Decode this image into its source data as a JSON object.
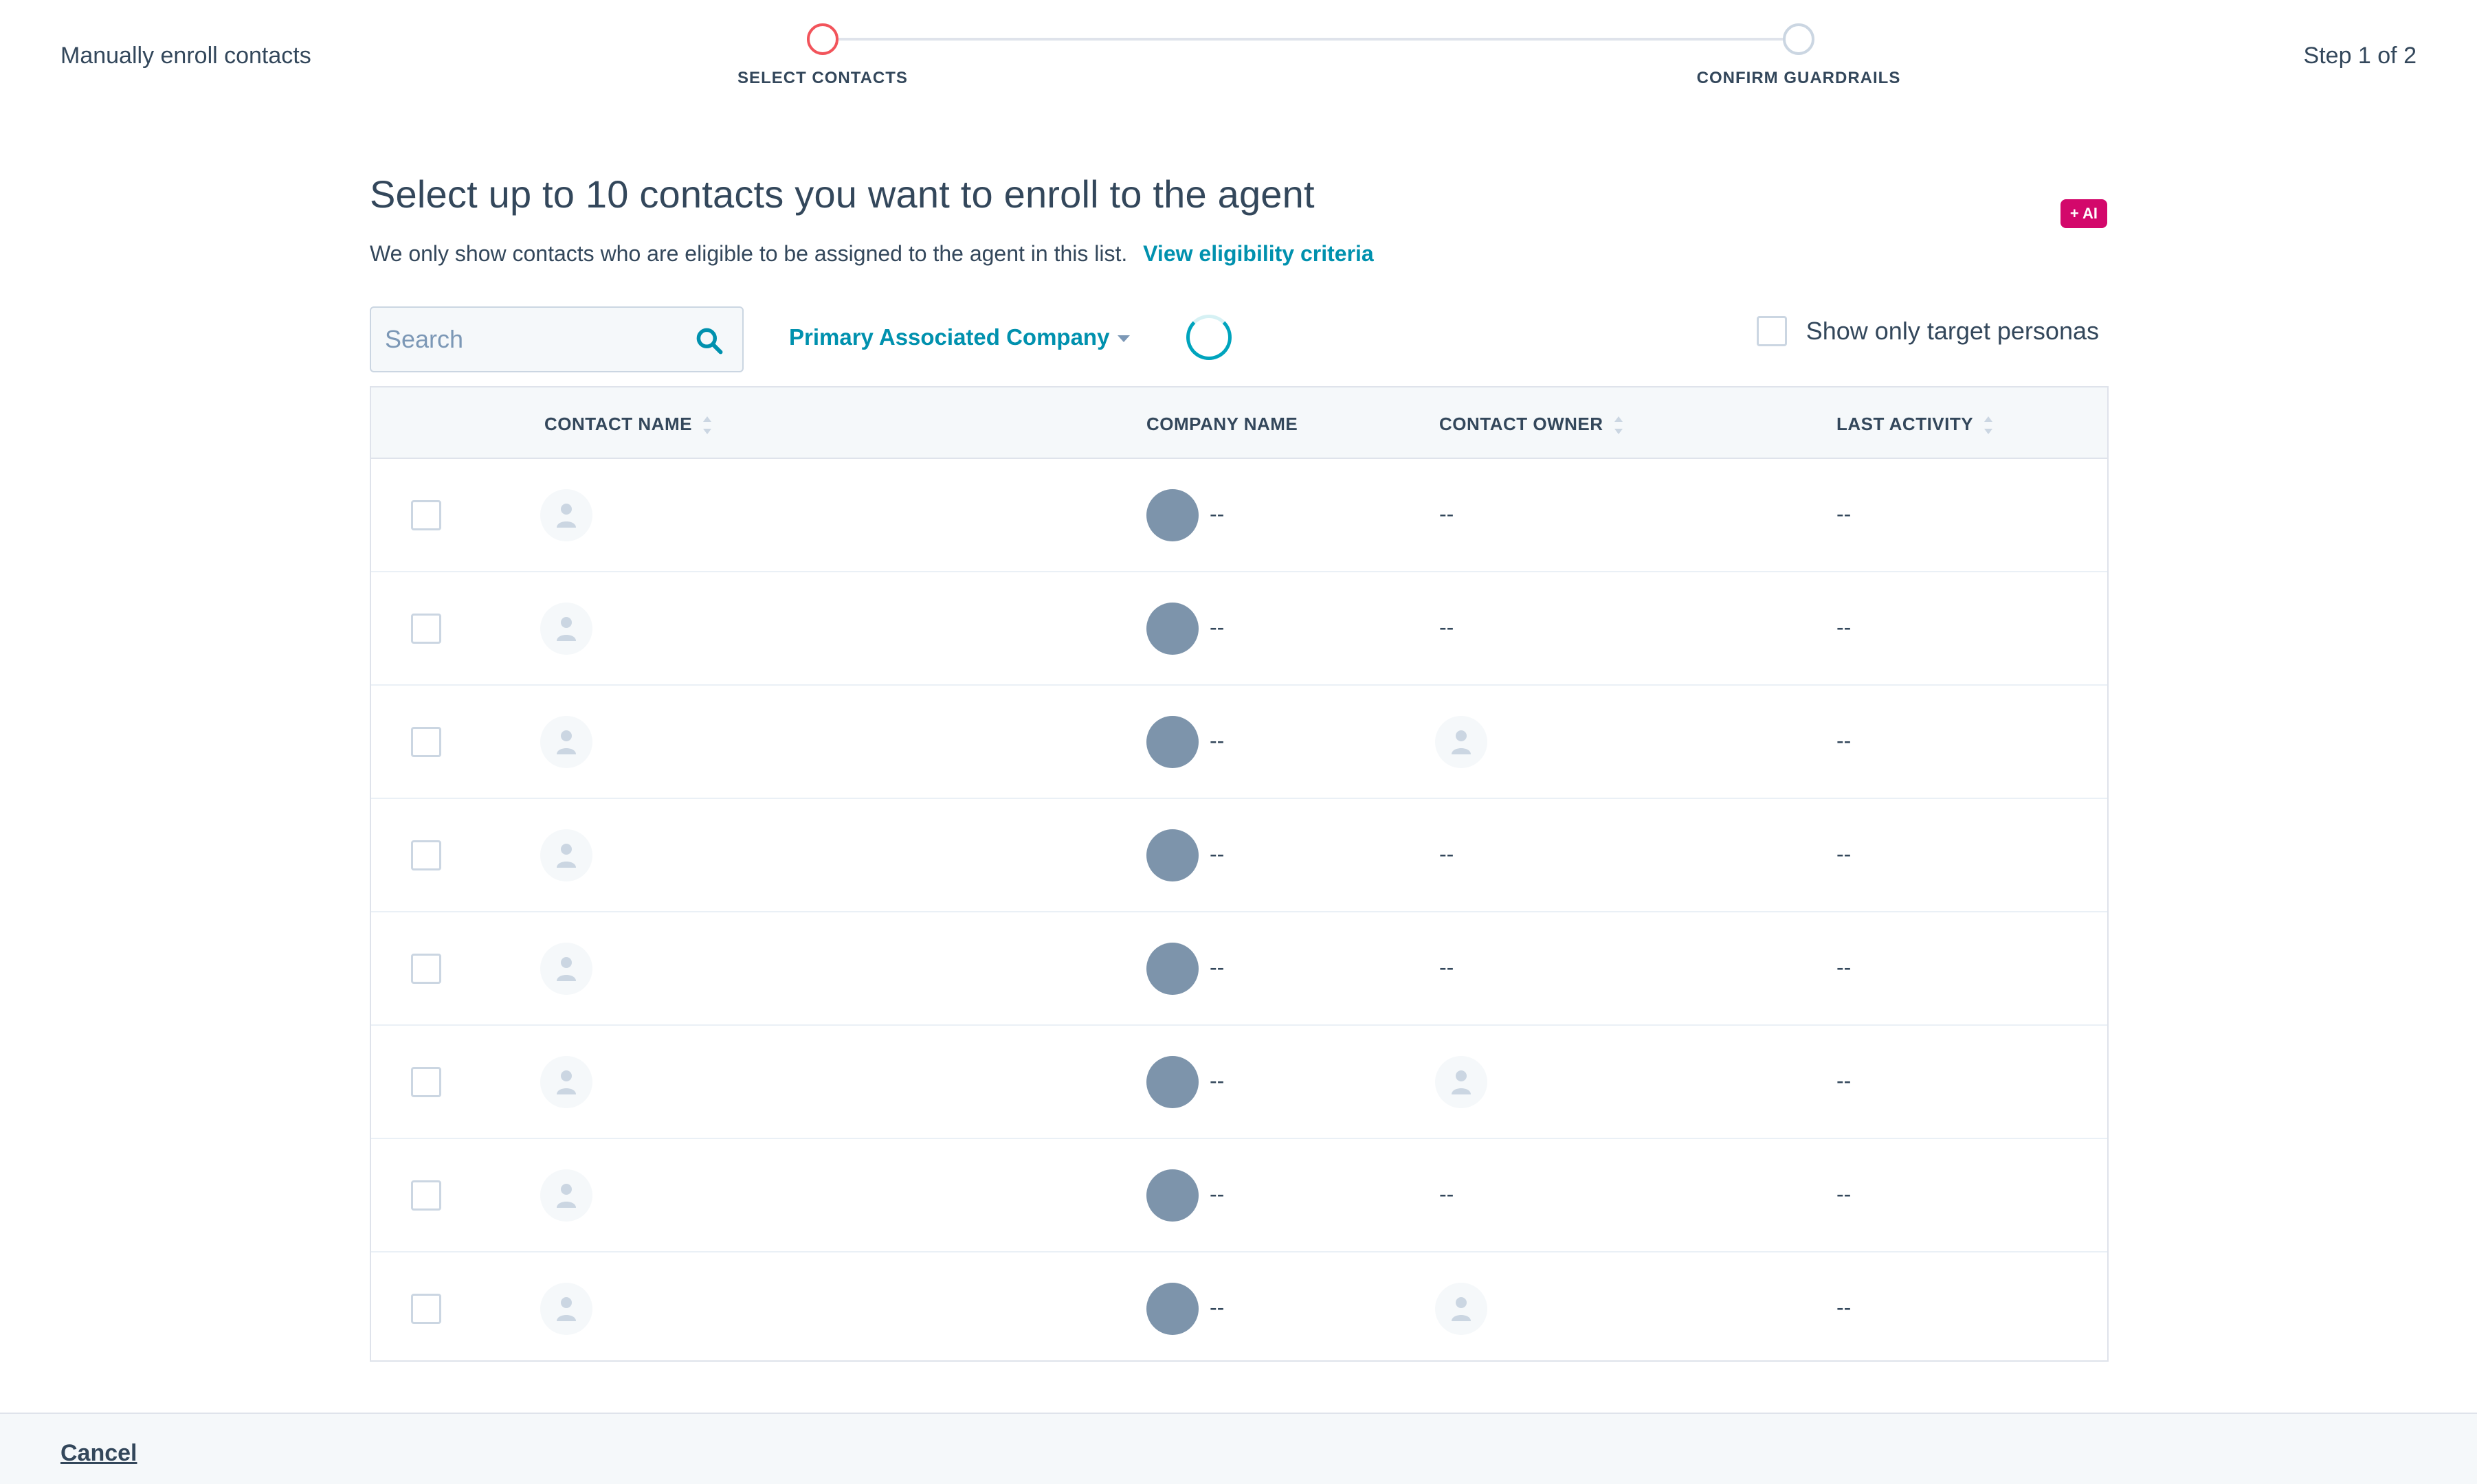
{
  "header": {
    "title": "Manually enroll contacts",
    "step_counter": "Step 1 of 2",
    "steps": [
      {
        "label": "SELECT CONTACTS",
        "state": "active"
      },
      {
        "label": "CONFIRM GUARDRAILS",
        "state": "inactive"
      }
    ]
  },
  "main": {
    "title": "Select up to 10 contacts you want to enroll to the agent",
    "ai_badge": "+ AI",
    "subtitle": "We only show contacts who are eligible to be assigned to the agent in this list.",
    "eligibility_link": "View eligibility criteria"
  },
  "toolbar": {
    "search": {
      "placeholder": "Search",
      "value": ""
    },
    "filter_label": "Primary Associated Company",
    "persona_toggle_label": "Show only target personas",
    "persona_toggle_checked": false
  },
  "table": {
    "columns": {
      "contact_name": "CONTACT NAME",
      "company_name": "COMPANY NAME",
      "contact_owner": "CONTACT OWNER",
      "last_activity": "LAST ACTIVITY"
    },
    "rows": [
      {
        "company": "--",
        "owner": "--",
        "owner_avatar": false,
        "activity": "--"
      },
      {
        "company": "--",
        "owner": "--",
        "owner_avatar": false,
        "activity": "--"
      },
      {
        "company": "--",
        "owner": "",
        "owner_avatar": true,
        "activity": "--"
      },
      {
        "company": "--",
        "owner": "--",
        "owner_avatar": false,
        "activity": "--"
      },
      {
        "company": "--",
        "owner": "--",
        "owner_avatar": false,
        "activity": "--"
      },
      {
        "company": "--",
        "owner": "",
        "owner_avatar": true,
        "activity": "--"
      },
      {
        "company": "--",
        "owner": "--",
        "owner_avatar": false,
        "activity": "--"
      },
      {
        "company": "--",
        "owner": "",
        "owner_avatar": true,
        "activity": "--"
      }
    ]
  },
  "footer": {
    "cancel_label": "Cancel"
  },
  "colors": {
    "accent_link": "#0091ae",
    "active_step": "#f2545b",
    "ai_badge": "#d3086b",
    "company_logo": "#7d94ab",
    "text": "#33475b"
  },
  "icons": {
    "search": "search-icon",
    "person": "person-icon",
    "caret": "chevron-down-icon",
    "spinner": "loading-spinner"
  }
}
